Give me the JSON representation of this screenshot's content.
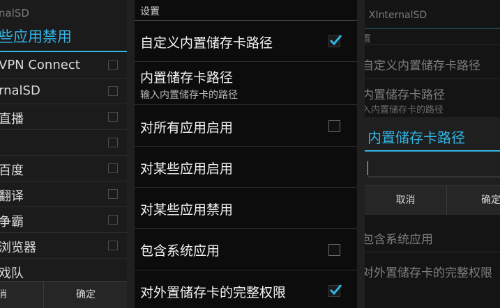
{
  "left_dialog": {
    "topline": "nalSD",
    "title": "些应用禁用",
    "items": [
      {
        "label": "VPN Connect"
      },
      {
        "label": "rnalSD"
      },
      {
        "label": "直播"
      },
      {
        "label": ""
      },
      {
        "label": "百度"
      },
      {
        "label": "翻译"
      },
      {
        "label": "争霸"
      },
      {
        "label": "浏览器"
      },
      {
        "label": "戏队"
      }
    ],
    "cancel_label": "消",
    "ok_label": "确定"
  },
  "settings": {
    "section_title": "设置",
    "items": [
      {
        "title": "自定义内置储存卡路径",
        "checked": true
      },
      {
        "title": "内置储存卡路径",
        "summary": "输入内置储存卡的路径"
      },
      {
        "title": "对所有应用启用",
        "checked": false
      },
      {
        "title": "对某些应用启用"
      },
      {
        "title": "对某些应用禁用"
      },
      {
        "title": "包含系统应用",
        "checked": false
      },
      {
        "title": "对外置储存卡的完整权限",
        "checked": true
      }
    ]
  },
  "right_dialog": {
    "app_title": ") XInternalSD",
    "section_title": "置",
    "bg_item1_title": "自定义内置储存卡路径",
    "bg_item2_title": "内置储存卡路径",
    "bg_item2_summary": "入内置储存卡的路径",
    "dialog_title": "内置储存卡路径",
    "input_value": "",
    "cancel_label": "取消",
    "ok_label": "确定",
    "bg_item3_title": "包含系统应用",
    "bg_item4_title": "对外置储存卡的完整权限"
  },
  "colors": {
    "accent": "#33b5e5",
    "background": "#000000"
  }
}
